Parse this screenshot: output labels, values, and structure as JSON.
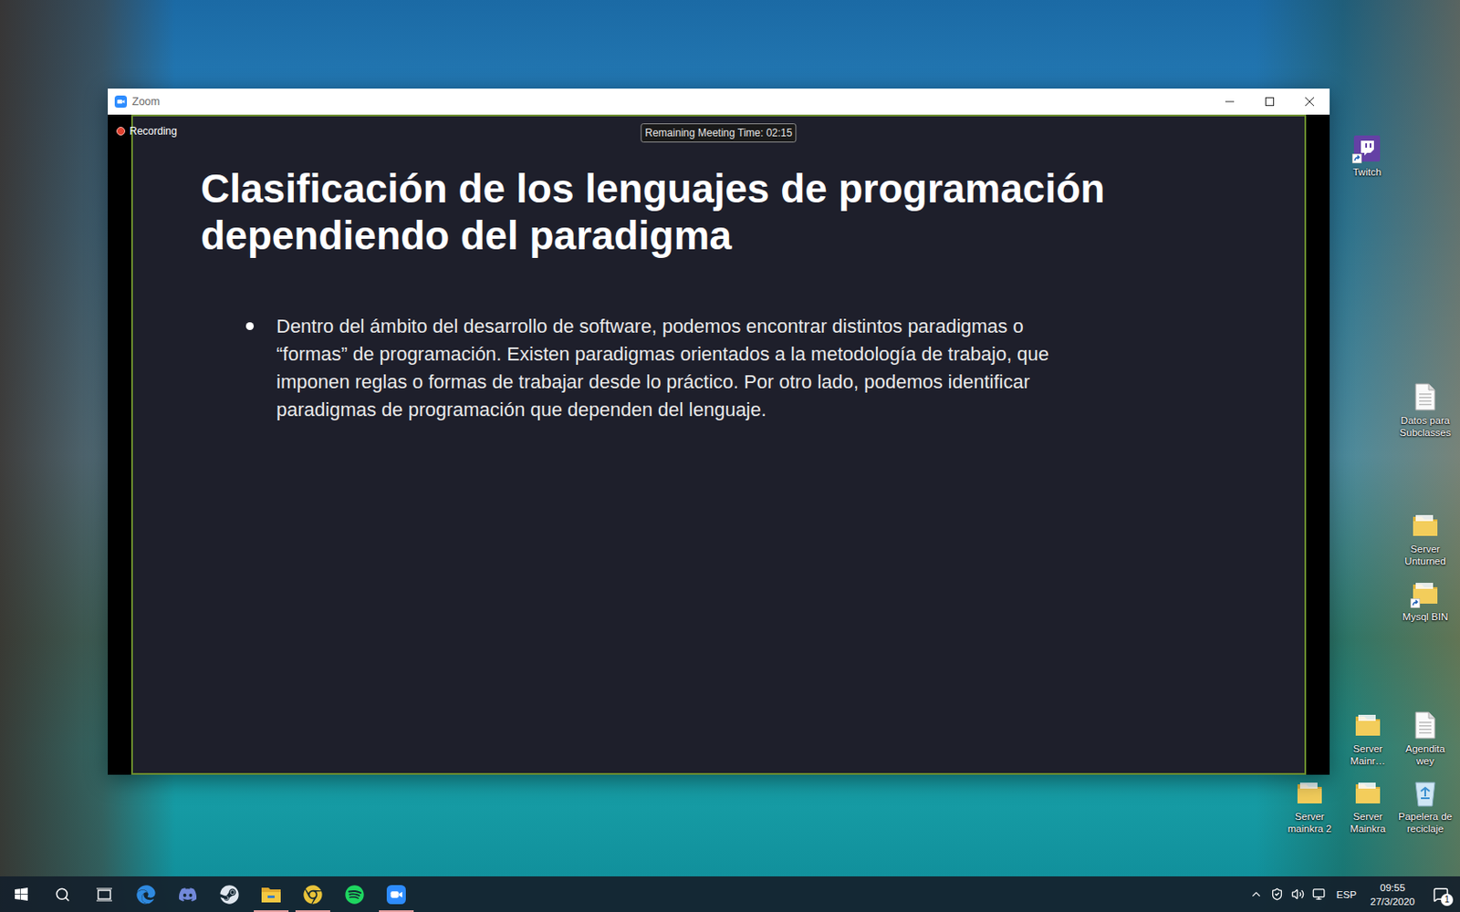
{
  "window": {
    "title": "Zoom"
  },
  "recording": {
    "label": "Recording",
    "on": true
  },
  "meeting_timer": "Remaining Meeting Time: 02:15",
  "slide": {
    "title": "Clasificación de los lenguajes de programación dependiendo del paradigma",
    "bullets": [
      "Dentro del ámbito del desarrollo de software, podemos encontrar distintos paradigmas o “formas” de programación. Existen paradigmas orientados a la metodología de trabajo, que imponen reglas o formas de trabajar desde lo práctico. Por otro lado, podemos identificar paradigmas de programación que dependen del lenguaje."
    ]
  },
  "desktop_icons": [
    {
      "label": "Twitch",
      "kind": "twitch"
    },
    {
      "label": "Datos para Subclasses",
      "kind": "document"
    },
    {
      "label": "Server Unturned",
      "kind": "folder"
    },
    {
      "label": "Mysql BIN",
      "kind": "foldershortcut"
    },
    {
      "label": "Server Mainr…",
      "kind": "folder"
    },
    {
      "label": "Agendita wey",
      "kind": "document"
    },
    {
      "label": "Server mainkra 2",
      "kind": "folder"
    },
    {
      "label": "Server Mainkra",
      "kind": "folder"
    },
    {
      "label": "Papelera de reciclaje",
      "kind": "recycle"
    }
  ],
  "taskbar": {
    "apps": [
      {
        "kind": "edge",
        "running": false
      },
      {
        "kind": "discord",
        "running": false
      },
      {
        "kind": "steam",
        "running": false
      },
      {
        "kind": "explorer",
        "running": true
      },
      {
        "kind": "chrome",
        "running": true
      },
      {
        "kind": "spotify",
        "running": false
      },
      {
        "kind": "zoom",
        "running": true
      }
    ],
    "language": "ESP",
    "time": "09:55",
    "date": "27/3/2020",
    "notifications": "1"
  }
}
